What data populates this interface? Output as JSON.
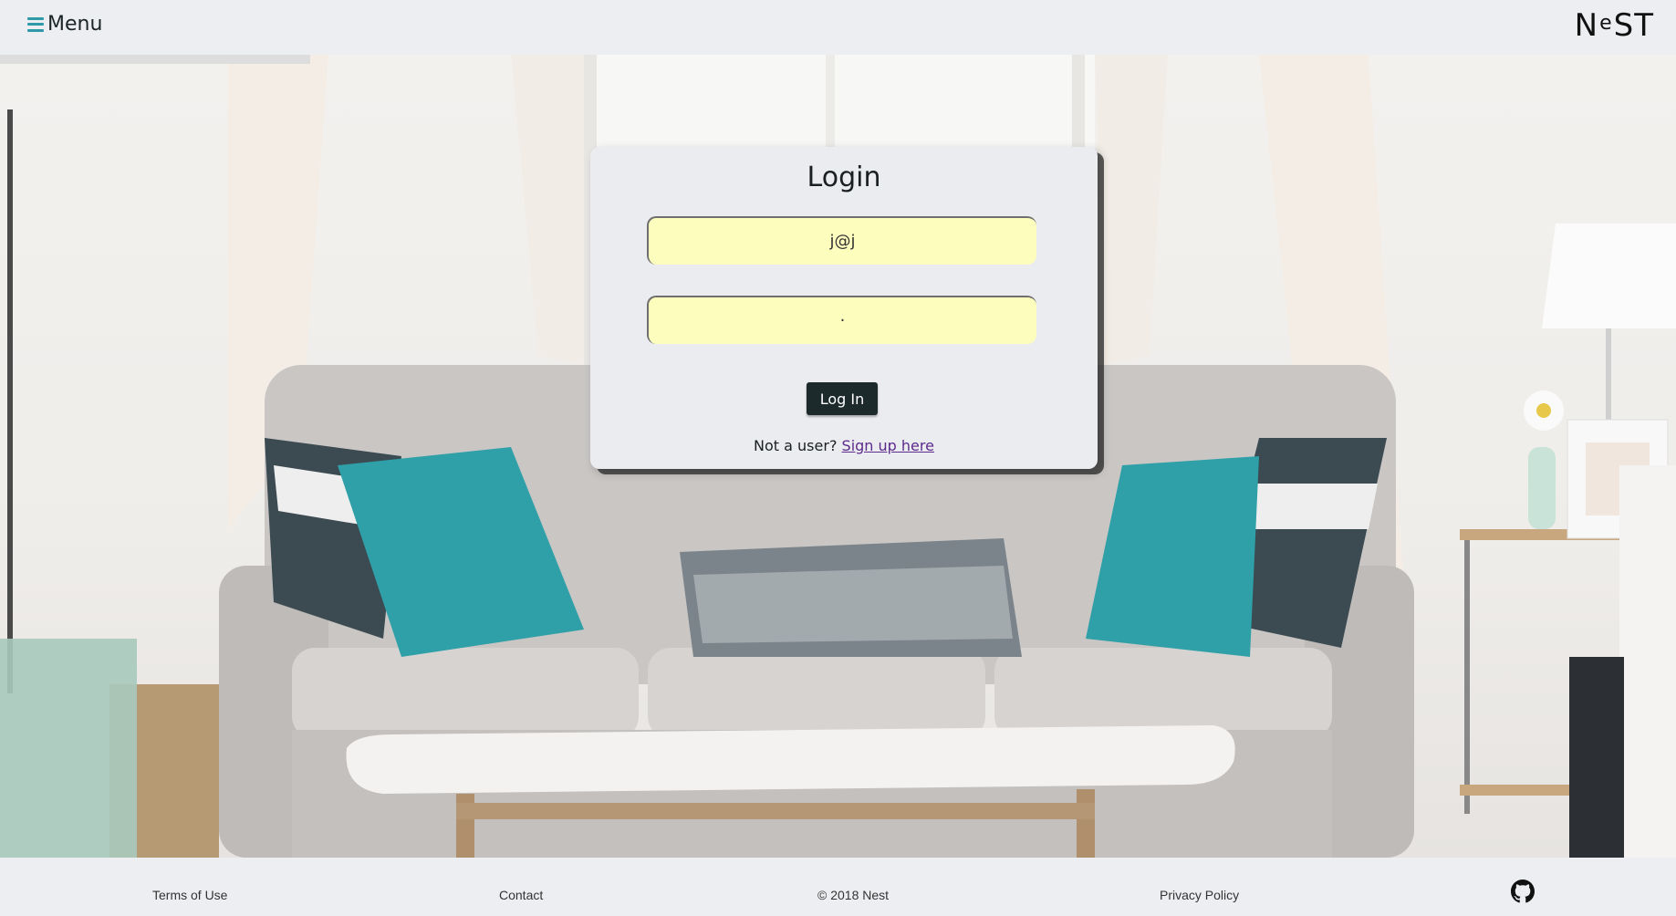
{
  "header": {
    "menu_label": "Menu",
    "menu_icon": "hamburger-icon",
    "logo_left": "N",
    "logo_middle": "e",
    "logo_right": "ST"
  },
  "login": {
    "title": "Login",
    "email_value": "j@j",
    "password_value": "·",
    "submit_label": "Log In",
    "signup_prompt": "Not a user?",
    "signup_link": "Sign up here"
  },
  "footer": {
    "terms": "Terms of Use",
    "contact": "Contact",
    "copyright": "© 2018 Nest",
    "privacy": "Privacy Policy",
    "github_icon": "github-icon"
  },
  "colors": {
    "accent": "#2e9aa8",
    "button_bg": "#1c2a2c",
    "field_bg": "#fdfdbd",
    "link": "#5c2a8c",
    "header_bg": "#eceef1"
  }
}
